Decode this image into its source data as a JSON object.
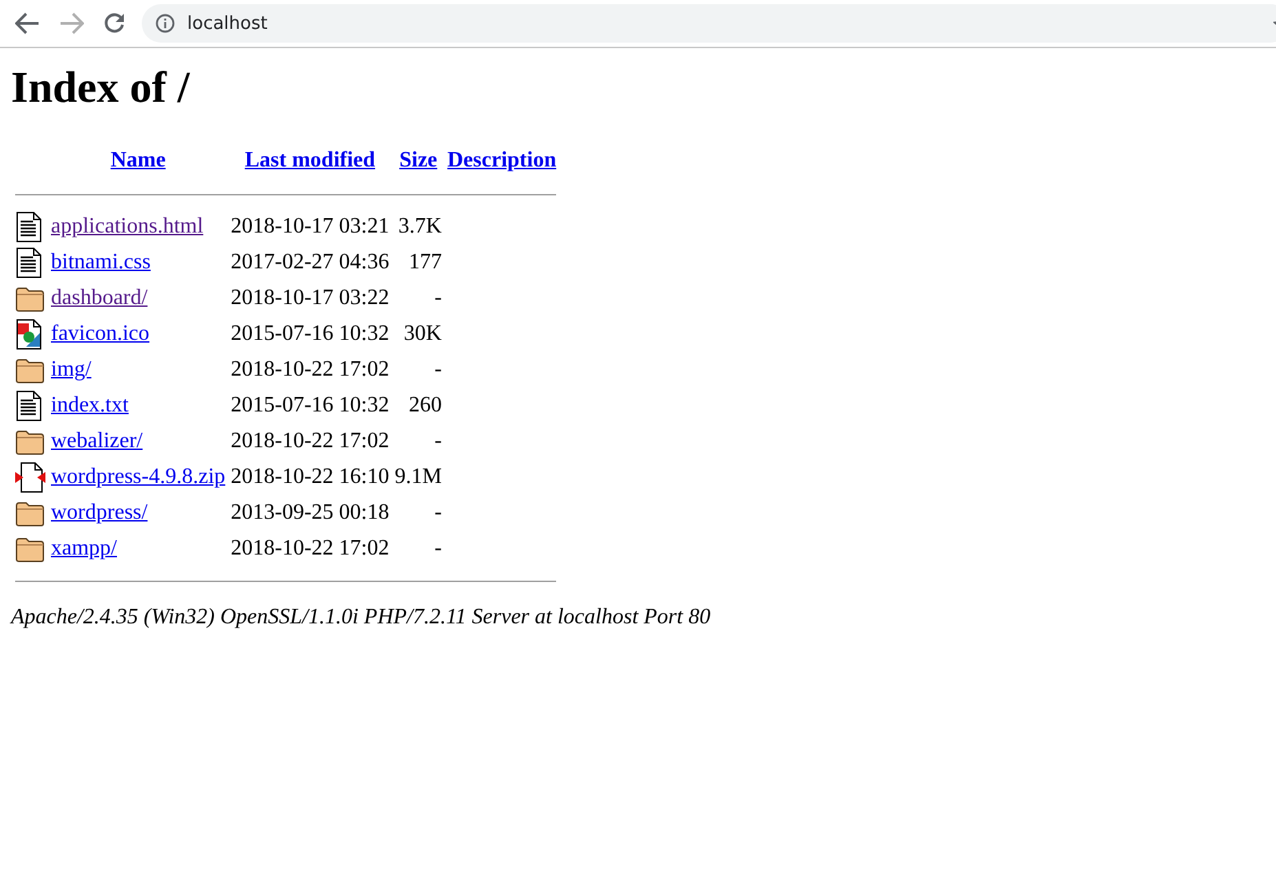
{
  "browser": {
    "url": "localhost",
    "forward_disabled": true
  },
  "page": {
    "title": "Index of /",
    "columns": [
      "Name",
      "Last modified",
      "Size",
      "Description"
    ],
    "rows": [
      {
        "kind": "text",
        "name": "applications.html",
        "visited": true,
        "modified": "2018-10-17 03:21",
        "size": "3.7K"
      },
      {
        "kind": "text",
        "name": "bitnami.css",
        "visited": false,
        "modified": "2017-02-27 04:36",
        "size": "177"
      },
      {
        "kind": "folder",
        "name": "dashboard/",
        "visited": true,
        "modified": "2018-10-17 03:22",
        "size": "-"
      },
      {
        "kind": "image",
        "name": "favicon.ico",
        "visited": false,
        "modified": "2015-07-16 10:32",
        "size": "30K"
      },
      {
        "kind": "folder",
        "name": "img/",
        "visited": false,
        "modified": "2018-10-22 17:02",
        "size": "-"
      },
      {
        "kind": "text",
        "name": "index.txt",
        "visited": false,
        "modified": "2015-07-16 10:32",
        "size": "260"
      },
      {
        "kind": "folder",
        "name": "webalizer/",
        "visited": false,
        "modified": "2018-10-22 17:02",
        "size": "-"
      },
      {
        "kind": "archive",
        "name": "wordpress-4.9.8.zip",
        "visited": false,
        "modified": "2018-10-22 16:10",
        "size": "9.1M"
      },
      {
        "kind": "folder",
        "name": "wordpress/",
        "visited": false,
        "modified": "2013-09-25 00:18",
        "size": "-"
      },
      {
        "kind": "folder",
        "name": "xampp/",
        "visited": false,
        "modified": "2018-10-22 17:02",
        "size": "-"
      }
    ],
    "footer": "Apache/2.4.35 (Win32) OpenSSL/1.1.0i PHP/7.2.11 Server at localhost Port 80"
  }
}
